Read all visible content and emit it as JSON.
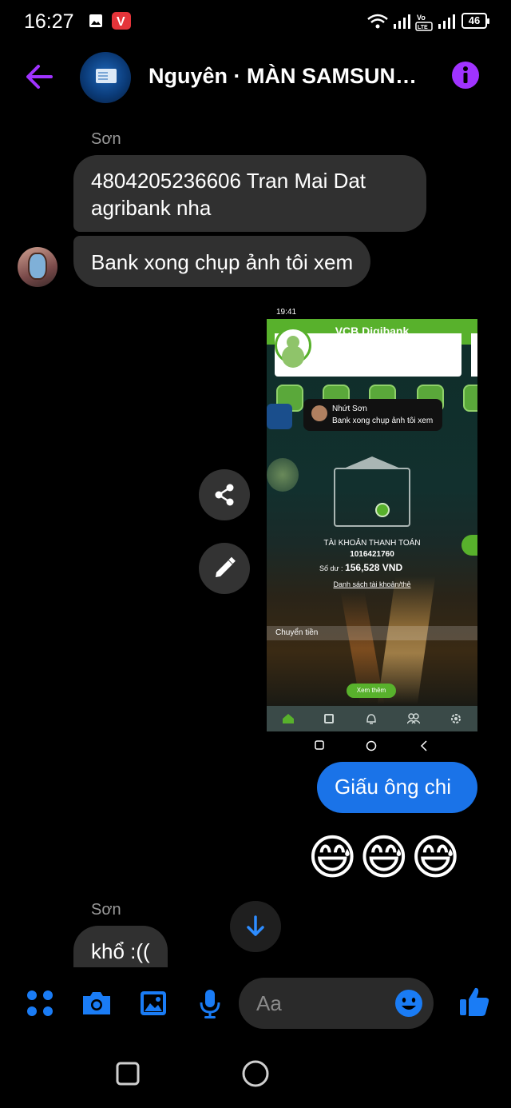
{
  "status_bar": {
    "time": "16:27",
    "battery": "46"
  },
  "header": {
    "title": "Nguyên · MÀN SAMSUNG..."
  },
  "messages": {
    "sender_1": "Sơn",
    "msg_1": "4804205236606 Tran Mai Dat agribank nha",
    "msg_2": "Bank xong chụp ảnh tôi xem",
    "my_msg": "Giấu ông chi",
    "emojis": "😅😅😅",
    "sender_2": "Sơn",
    "msg_3": "khổ :(("
  },
  "shared_screenshot": {
    "time": "19:41",
    "app_title": "VCB Digibank",
    "notif_name": "Nhứt Sơn",
    "notif_text": "Bank xong chụp ảnh tôi xem",
    "account_label": "TÀI KHOẢN THANH TOÁN",
    "account_number": "1016421760",
    "balance_label": "Số dư :",
    "balance_value": "156,528 VND",
    "account_list_link": "Danh sách tài khoản/thẻ",
    "transfer_label": "Chuyển tiền",
    "more_button": "Xem thêm"
  },
  "composer": {
    "placeholder": "Aa"
  },
  "colors": {
    "accent": "#a033ff",
    "blue": "#1a73e8",
    "bubble": "#303030",
    "vcb_green": "#58b12c"
  }
}
